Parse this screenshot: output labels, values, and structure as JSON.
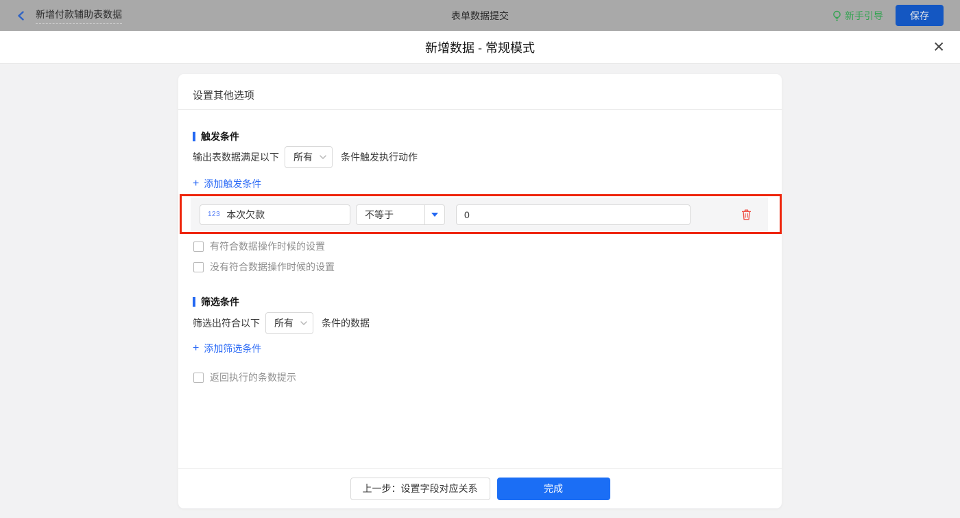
{
  "topbar": {
    "back_title": "新增付款辅助表数据",
    "center_title": "表单数据提交",
    "guide_label": "新手引导",
    "save_label": "保存"
  },
  "modal": {
    "title": "新增数据 - 常规模式",
    "close_glyph": "✕"
  },
  "card": {
    "title": "设置其他选项",
    "trigger_section": {
      "heading": "触发条件",
      "sentence_prefix": "输出表数据满足以下",
      "match_select_value": "所有",
      "sentence_suffix": "条件触发执行动作",
      "add_link": "添加触发条件",
      "condition_row": {
        "field_type_badge": "123",
        "field_name": "本次欠款",
        "operator": "不等于",
        "value": "0"
      },
      "checkboxes": [
        {
          "label": "有符合数据操作时候的设置",
          "checked": false
        },
        {
          "label": "没有符合数据操作时候的设置",
          "checked": false
        }
      ]
    },
    "filter_section": {
      "heading": "筛选条件",
      "sentence_prefix": "筛选出符合以下",
      "match_select_value": "所有",
      "sentence_suffix": "条件的数据",
      "add_link": "添加筛选条件",
      "checkboxes": [
        {
          "label": "返回执行的条数提示",
          "checked": false
        }
      ]
    },
    "footer": {
      "prev_label": "上一步：设置字段对应关系",
      "done_label": "完成"
    }
  },
  "icons": {
    "plus_glyph": "+"
  },
  "colors": {
    "accent_blue": "#1b6ef5",
    "link_blue": "#2e6cf6",
    "section_bar_blue": "#2468f2",
    "highlight_red": "#ee250b",
    "trash_red": "#ef4c41",
    "guide_green": "#35a352",
    "topbar_dimmed_gray": "#a9a9a9",
    "page_background": "#f2f2f3"
  }
}
